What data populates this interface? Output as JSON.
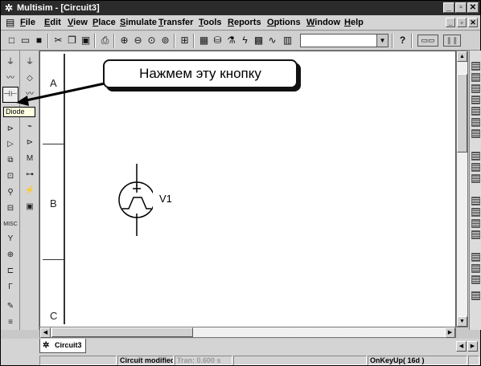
{
  "window": {
    "title": "Multisim - [Circuit3]",
    "app_icon": "multisim-icon"
  },
  "menu": {
    "items": [
      "File",
      "Edit",
      "View",
      "Place",
      "Simulate",
      "Transfer",
      "Tools",
      "Reports",
      "Options",
      "Window",
      "Help"
    ]
  },
  "toolbar": {
    "help_glyph": "?",
    "icons": [
      "new-icon",
      "open-icon",
      "save-icon",
      "cut-icon",
      "copy-icon",
      "paste-icon",
      "print-icon",
      "zoom-in-icon",
      "zoom-out-icon",
      "zoom-area-icon",
      "zoom-fit-icon",
      "hierarchy-icon",
      "spreadsheet-icon",
      "database-icon",
      "component-wizard-icon",
      "postprocessor-icon",
      "grapher-icon",
      "analysis-icon",
      "in-use-list-icon",
      "help-icon",
      "simulate-switch-icon",
      "pause-icon"
    ]
  },
  "callout": {
    "text": "Нажмем эту кнопку"
  },
  "tooltip": {
    "text": "Diode"
  },
  "schematic": {
    "zones": [
      "A",
      "B",
      "C"
    ],
    "component_label": "V1",
    "component_icon": "voltage-source-icon"
  },
  "tabs": [
    {
      "label": "Circuit3",
      "icon": "circuit-icon"
    }
  ],
  "status": {
    "cells": [
      "",
      "Circuit modified",
      "Tran: 0.600 s",
      "",
      "OnKeyUp( 16d )",
      ""
    ]
  },
  "colors": {
    "titlebar": "#2b2b2b",
    "chrome": "#d4d4d4",
    "tooltip": "#ffffe1",
    "disabled_text": "#9a9a9a"
  }
}
